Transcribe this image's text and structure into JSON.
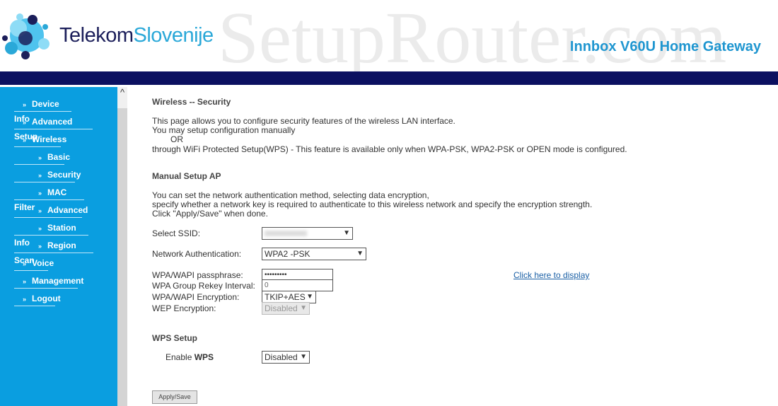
{
  "header": {
    "brand_part1": "Telekom",
    "brand_part2": "Slovenije",
    "watermark": "SetupRouter.com",
    "product": "Innbox V60U Home Gateway"
  },
  "sidebar": {
    "items": [
      {
        "label": "Device Info",
        "level": 1
      },
      {
        "label": "Advanced Setup",
        "level": 1
      },
      {
        "label": "Wireless",
        "level": 1
      },
      {
        "label": "Basic",
        "level": 2
      },
      {
        "label": "Security",
        "level": 2
      },
      {
        "label": "MAC Filter",
        "level": 2
      },
      {
        "label": "Advanced",
        "level": 2
      },
      {
        "label": "Station Info",
        "level": 2
      },
      {
        "label": "Region Scan",
        "level": 2
      },
      {
        "label": "Voice",
        "level": 1
      },
      {
        "label": "Management",
        "level": 1
      },
      {
        "label": "Logout",
        "level": 1
      }
    ],
    "chevron": "»"
  },
  "main": {
    "title": "Wireless -- Security",
    "intro": [
      "This page allows you to configure security features of the wireless LAN interface.",
      "You may setup configuration manually",
      "OR",
      "through WiFi Protected Setup(WPS) - This feature is available only when WPA-PSK, WPA2-PSK or OPEN mode is configured."
    ],
    "manual_title": "Manual Setup AP",
    "manual_desc": [
      "You can set the network authentication method, selecting data encryption,",
      "specify whether a network key is required to authenticate to this wireless network and specify the encryption strength.",
      "Click \"Apply/Save\" when done."
    ],
    "ssid_label": "Select SSID:",
    "auth_label": "Network Authentication:",
    "auth_value": "WPA2 -PSK",
    "pass_label": "WPA/WAPI passphrase:",
    "pass_value": "•••••••••",
    "display_link": "Click here to display",
    "rekey_label": "WPA Group Rekey Interval:",
    "rekey_value": "0",
    "enc_label": "WPA/WAPI Encryption:",
    "enc_value": "TKIP+AES",
    "wep_label": "WEP Encryption:",
    "wep_value": "Disabled",
    "wps_title": "WPS Setup",
    "wps_label_pre": "Enable ",
    "wps_label_bold": "WPS",
    "wps_value": "Disabled",
    "apply": "Apply/Save"
  }
}
